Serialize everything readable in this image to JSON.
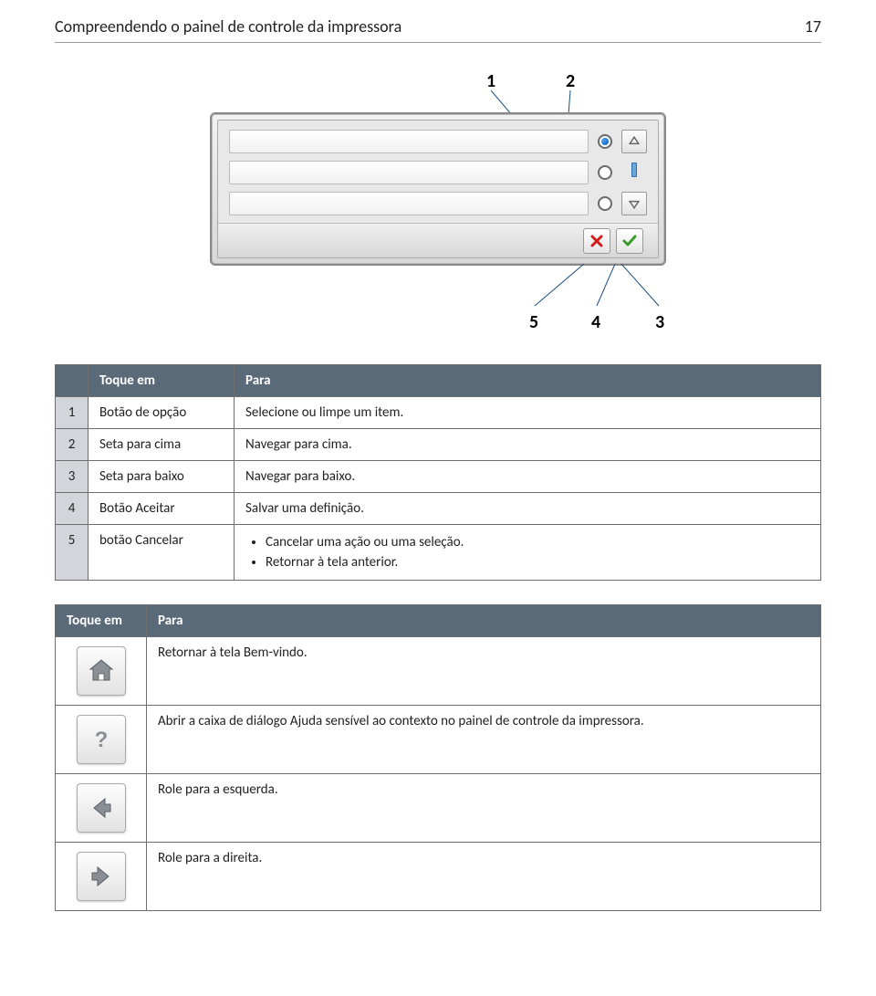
{
  "header": {
    "title": "Compreendendo o painel de controle da impressora",
    "page_number": "17"
  },
  "figure": {
    "callouts_top": {
      "c1": "1",
      "c2": "2"
    },
    "callouts_bottom": {
      "c5": "5",
      "c4": "4",
      "c3": "3"
    }
  },
  "table1": {
    "head": {
      "col1": "Toque em",
      "col2": "Para"
    },
    "rows": [
      {
        "num": "1",
        "name": "Botão de opção",
        "desc": "Selecione ou limpe um item."
      },
      {
        "num": "2",
        "name": "Seta para cima",
        "desc": "Navegar para cima."
      },
      {
        "num": "3",
        "name": "Seta para baixo",
        "desc": "Navegar para baixo."
      },
      {
        "num": "4",
        "name": "Botão Aceitar",
        "desc": "Salvar uma definição."
      }
    ],
    "row5": {
      "num": "5",
      "name": "botão Cancelar",
      "bullets": [
        "Cancelar uma ação ou uma seleção.",
        "Retornar à tela anterior."
      ]
    }
  },
  "table2": {
    "head": {
      "col1": "Toque em",
      "col2": "Para"
    },
    "rows": [
      {
        "icon": "home-icon",
        "desc": "Retornar à tela Bem-vindo."
      },
      {
        "icon": "help-icon",
        "desc": "Abrir a caixa de diálogo Ajuda sensível ao contexto no painel de controle da impressora."
      },
      {
        "icon": "arrow-left-icon",
        "desc": "Role para a esquerda."
      },
      {
        "icon": "arrow-right-icon",
        "desc": "Role para a direita."
      }
    ]
  }
}
